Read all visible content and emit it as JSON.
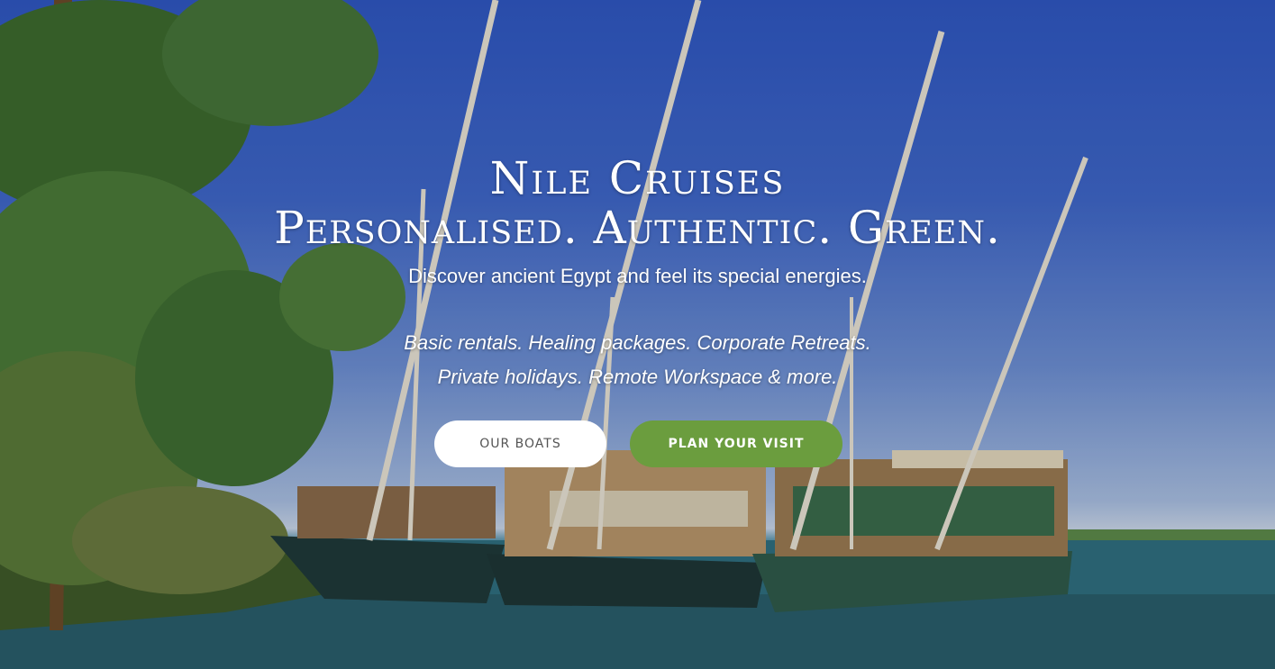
{
  "hero": {
    "title_line1": "Nile Cruises",
    "title_line2": "Personalised. Authentic. Green.",
    "subtitle": "Discover ancient Egypt and feel its special energies.",
    "tagline_line1": "Basic rentals. Healing packages. Corporate Retreats.",
    "tagline_line2": "Private holidays. Remote Workspace & more."
  },
  "buttons": {
    "our_boats": "OUR BOATS",
    "plan_visit": "PLAN YOUR VISIT"
  },
  "colors": {
    "sky": "#3f67c9",
    "accent_green": "#6b9d3e",
    "button_white": "#ffffff",
    "water": "#2c6a7a"
  },
  "background_image": {
    "subject": "dahabiya sailing boats moored on the Nile riverbank with palm trees"
  }
}
